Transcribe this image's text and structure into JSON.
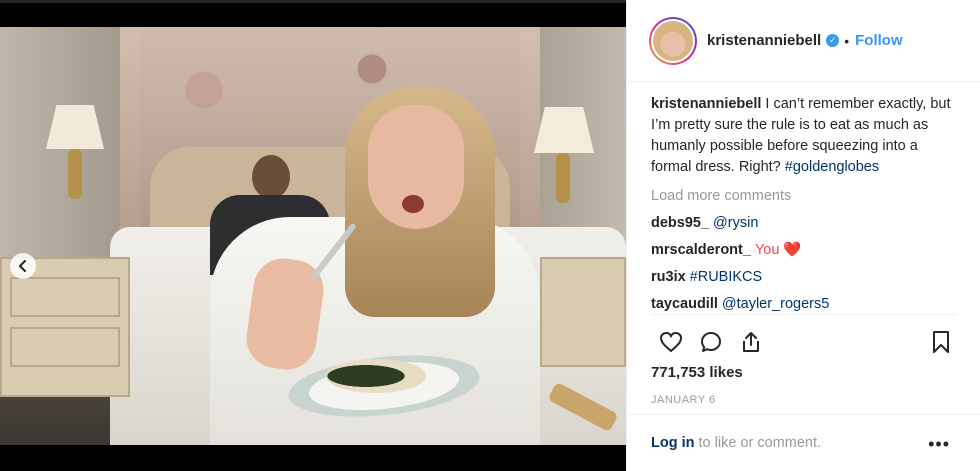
{
  "post": {
    "username": "kristenanniebell",
    "verified": true,
    "follow_label": "Follow",
    "separator": "•",
    "caption_user": "kristenanniebell",
    "caption_text": "I can’t remember exactly, but I’m pretty sure the rule is to eat as much as humanly possible before squeezing into a formal dress. Right?",
    "caption_hashtag": "#goldenglobes",
    "load_more": "Load more comments",
    "comments": [
      {
        "user": "debs95_",
        "text": "@rysin"
      },
      {
        "user": "mrscalderont_",
        "text": "You ❤️"
      },
      {
        "user": "ru3ix",
        "text": "#RUBIKCS"
      },
      {
        "user": "taycaudill",
        "text": "@tayler_rogers5"
      }
    ],
    "likes": "771,753 likes",
    "date": "JANUARY 6",
    "login_link": "Log in",
    "login_text": " to like or comment.",
    "more_label": "•••",
    "carousel": {
      "count": 2,
      "active_index": 1
    }
  },
  "icons": {
    "like": "heart-icon",
    "comment": "comment-icon",
    "share": "share-icon",
    "save": "bookmark-icon",
    "prev": "chevron-left-icon",
    "verified": "verified-badge-icon"
  },
  "colors": {
    "accent": "#3897f0",
    "text": "#262626",
    "muted": "#999999",
    "link": "#003569"
  }
}
